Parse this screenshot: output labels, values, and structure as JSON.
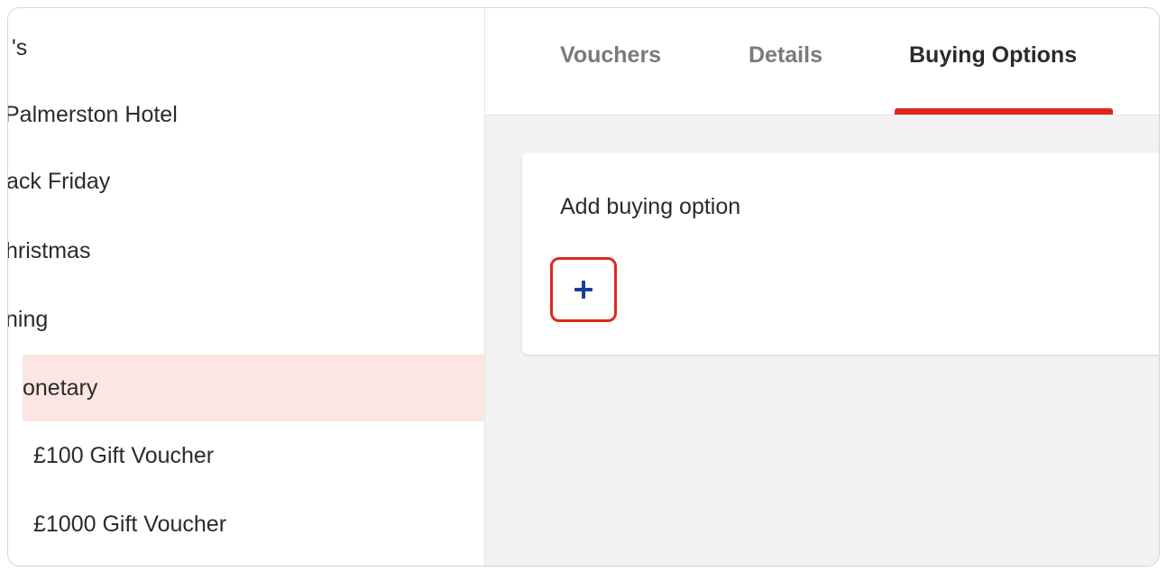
{
  "sidebar": {
    "items": [
      {
        "label": "'s",
        "selected": false
      },
      {
        "label": "Palmerston Hotel",
        "selected": false
      },
      {
        "label": "ack Friday",
        "selected": false
      },
      {
        "label": "hristmas",
        "selected": false
      },
      {
        "label": "ning",
        "selected": false
      },
      {
        "label": "onetary",
        "selected": true
      },
      {
        "label": "£100 Gift Voucher",
        "selected": false
      },
      {
        "label": "£1000 Gift Voucher",
        "selected": false
      }
    ]
  },
  "tabs": [
    {
      "label": "Vouchers",
      "active": false
    },
    {
      "label": "Details",
      "active": false
    },
    {
      "label": "Buying Options",
      "active": true
    }
  ],
  "card": {
    "title": "Add buying option",
    "add_button_icon": "plus-icon"
  },
  "colors": {
    "accent": "#e0261b",
    "selected_bg": "#fbe6e2",
    "icon_blue": "#1a3e9b",
    "main_bg": "#f2f2f2"
  }
}
